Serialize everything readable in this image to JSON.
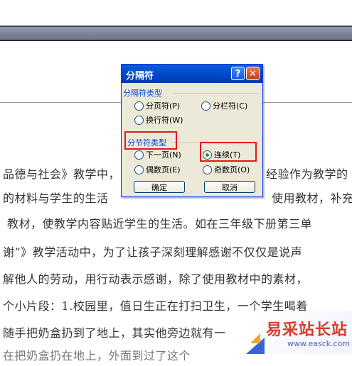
{
  "document": {
    "lines": [
      "品德与社会》教学中，",
      "的材料与学生的生活",
      "教材，使教学内容贴近学生的生活。如在三年级下册第三单",
      "谢”》教学活动中，为了让孩子深刻理解感谢不仅仅是说声",
      "解他人的劳动，用行动表示感谢，除了使用教材中的素材，",
      "个小片段：1.校园里，值日生正在打扫卫生，一个学生喝着",
      "随手把奶盒扔到了地上，其实他旁边就有一",
      "在把奶盒扔在地上，外面到过了这个"
    ],
    "right_fragments": [
      "经验作为教学的",
      "使用教材，补充"
    ]
  },
  "dialog": {
    "title": "分隔符",
    "help_glyph": "?",
    "close_glyph": "✕",
    "break_types_label": "分隔符类型",
    "page_break": "分页符(P)",
    "column_break": "分栏符(C)",
    "text_wrap_break": "换行符(W)",
    "section_types_label": "分节符类型",
    "next_page": "下一页(N)",
    "continuous": "连续(T)",
    "even_page": "偶数页(E)",
    "odd_page": "奇数页(O)",
    "ok": "确定",
    "cancel": "取消"
  },
  "watermark": {
    "brand": "易采站长站",
    "url": "www.easck.com"
  },
  "colors": {
    "highlight_box": "#e21a1a",
    "titlebar": "#0046c8",
    "dialog_bg": "#ece9d8"
  }
}
